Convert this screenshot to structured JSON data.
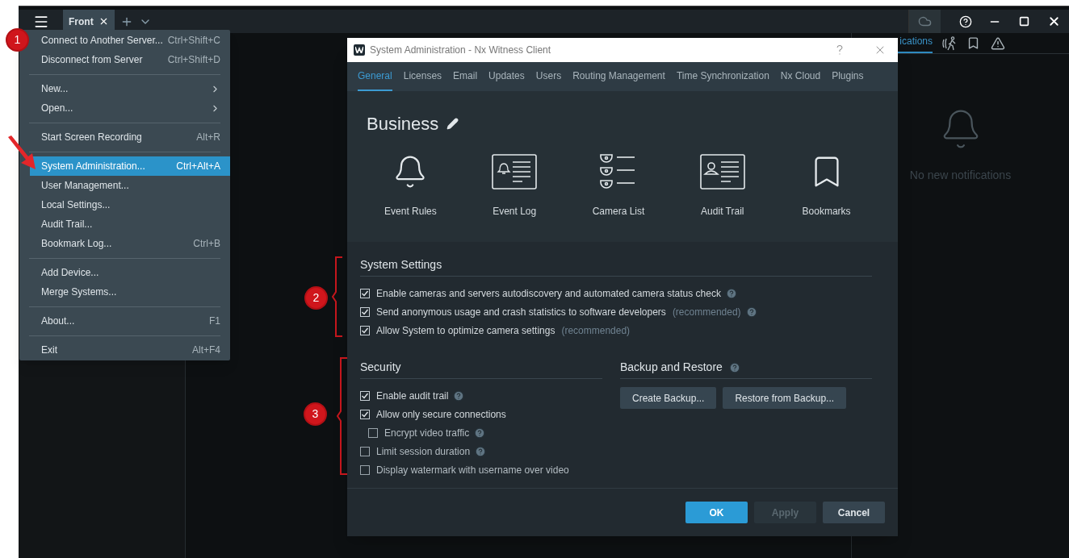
{
  "title_bar": {
    "tabs": [
      {
        "label": "Front",
        "selected": true
      }
    ]
  },
  "main_menu": {
    "items": [
      {
        "kind": "item",
        "label": "Connect to Another Server...",
        "shortcut": "Ctrl+Shift+C",
        "selected": false
      },
      {
        "kind": "item",
        "label": "Disconnect from Server",
        "shortcut": "Ctrl+Shift+D",
        "selected": false
      },
      {
        "kind": "separator"
      },
      {
        "kind": "submenu",
        "label": "New...",
        "selected": false
      },
      {
        "kind": "submenu",
        "label": "Open...",
        "selected": false
      },
      {
        "kind": "separator"
      },
      {
        "kind": "item",
        "label": "Start Screen Recording",
        "shortcut": "Alt+R",
        "selected": false
      },
      {
        "kind": "separator"
      },
      {
        "kind": "item",
        "label": "System Administration...",
        "shortcut": "Ctrl+Alt+A",
        "selected": true
      },
      {
        "kind": "item",
        "label": "User Management...",
        "selected": false
      },
      {
        "kind": "item",
        "label": "Local Settings...",
        "selected": false
      },
      {
        "kind": "item",
        "label": "Audit Trail...",
        "selected": false
      },
      {
        "kind": "item",
        "label": "Bookmark Log...",
        "shortcut": "Ctrl+B",
        "selected": false
      },
      {
        "kind": "separator"
      },
      {
        "kind": "item",
        "label": "Add Device...",
        "selected": false
      },
      {
        "kind": "item",
        "label": "Merge Systems...",
        "selected": false
      },
      {
        "kind": "separator"
      },
      {
        "kind": "item",
        "label": "About...",
        "shortcut": "F1",
        "selected": false
      },
      {
        "kind": "separator"
      },
      {
        "kind": "item",
        "label": "Exit",
        "shortcut": "Alt+F4",
        "selected": false
      }
    ]
  },
  "notifications_panel": {
    "tab_label": "ications",
    "empty_text": "No new notifications"
  },
  "dialog": {
    "title": "System Administration - Nx Witness Client",
    "tabs": [
      {
        "label": "General",
        "selected": true
      },
      {
        "label": "Licenses",
        "selected": false
      },
      {
        "label": "Email",
        "selected": false
      },
      {
        "label": "Updates",
        "selected": false
      },
      {
        "label": "Users",
        "selected": false
      },
      {
        "label": "Routing Management",
        "selected": false
      },
      {
        "label": "Time Synchronization",
        "selected": false
      },
      {
        "label": "Nx Cloud",
        "selected": false
      },
      {
        "label": "Plugins",
        "selected": false
      }
    ],
    "system_name": "Business",
    "shortcuts": [
      {
        "kind": "bell",
        "label": "Event Rules"
      },
      {
        "kind": "event-log",
        "label": "Event Log"
      },
      {
        "kind": "camera-list",
        "label": "Camera List"
      },
      {
        "kind": "audit",
        "label": "Audit Trail"
      },
      {
        "kind": "bookmark",
        "label": "Bookmarks"
      }
    ],
    "system_settings": {
      "heading": "System Settings",
      "options": [
        {
          "label": "Enable cameras and servers autodiscovery and automated camera status check",
          "checked": true,
          "help": true
        },
        {
          "label": "Send anonymous usage and crash statistics to software developers",
          "note": "(recommended)",
          "checked": true,
          "help": true
        },
        {
          "label": "Allow System to optimize camera settings",
          "note": "(recommended)",
          "checked": true,
          "help": false
        }
      ]
    },
    "security": {
      "heading": "Security",
      "options": [
        {
          "label": "Enable audit trail",
          "checked": true,
          "help": true
        },
        {
          "label": "Allow only secure connections",
          "checked": true,
          "help": false,
          "children": [
            {
              "label": "Encrypt video traffic",
              "checked": false,
              "help": true
            }
          ]
        },
        {
          "label": "Limit session duration",
          "checked": false,
          "help": true
        },
        {
          "label": "Display watermark with username over video",
          "checked": false,
          "help": false
        }
      ]
    },
    "backup": {
      "heading": "Backup and Restore",
      "help": true,
      "buttons": [
        "Create Backup...",
        "Restore from Backup..."
      ]
    },
    "buttons": [
      {
        "label": "OK",
        "kind": "primary",
        "disabled": false
      },
      {
        "label": "Apply",
        "kind": "normal",
        "disabled": true
      },
      {
        "label": "Cancel",
        "kind": "normal",
        "disabled": false
      }
    ]
  },
  "annotations": [
    {
      "label": "1"
    },
    {
      "label": "2"
    },
    {
      "label": "3"
    }
  ]
}
